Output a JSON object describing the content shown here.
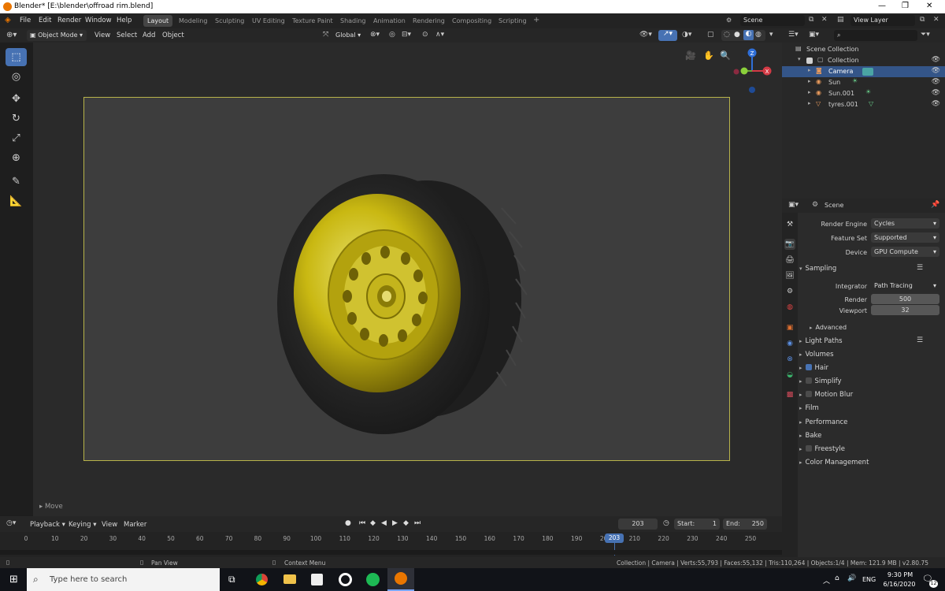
{
  "window": {
    "title": "Blender* [E:\\blender\\offroad rim.blend]",
    "min": "—",
    "restore": "❐",
    "close": "✕"
  },
  "menu": {
    "items": [
      "File",
      "Edit",
      "Render",
      "Window",
      "Help"
    ]
  },
  "workspaces": {
    "tabs": [
      "Layout",
      "Modeling",
      "Sculpting",
      "UV Editing",
      "Texture Paint",
      "Shading",
      "Animation",
      "Rendering",
      "Compositing",
      "Scripting"
    ],
    "add": "+",
    "active": "Layout"
  },
  "topright": {
    "scene": "Scene",
    "view_layer": "View Layer"
  },
  "viewport_header": {
    "mode": "Object Mode",
    "menus": [
      "View",
      "Select",
      "Add",
      "Object"
    ],
    "orientation": "Global"
  },
  "viewport": {
    "last_op": "Move",
    "gizmo_z": "Z",
    "gizmo_x": "X"
  },
  "outliner": {
    "items": [
      {
        "label": "Scene Collection",
        "indent": 0
      },
      {
        "label": "Collection",
        "indent": 1
      },
      {
        "label": "Camera",
        "indent": 2
      },
      {
        "label": "Sun",
        "indent": 2
      },
      {
        "label": "Sun.001",
        "indent": 2
      },
      {
        "label": "tyres.001",
        "indent": 2
      }
    ],
    "selected": "Camera"
  },
  "properties": {
    "context": "Scene",
    "render_engine": {
      "label": "Render Engine",
      "value": "Cycles"
    },
    "feature_set": {
      "label": "Feature Set",
      "value": "Supported"
    },
    "device": {
      "label": "Device",
      "value": "GPU Compute"
    },
    "sampling": {
      "title": "Sampling",
      "integrator_label": "Integrator",
      "integrator": "Path Tracing",
      "render_label": "Render",
      "render": "500",
      "viewport_label": "Viewport",
      "viewport": "32",
      "advanced": "Advanced"
    },
    "sections": [
      {
        "label": "Light Paths",
        "checkbox": null
      },
      {
        "label": "Volumes",
        "checkbox": null
      },
      {
        "label": "Hair",
        "checkbox": true
      },
      {
        "label": "Simplify",
        "checkbox": false
      },
      {
        "label": "Motion Blur",
        "checkbox": false
      },
      {
        "label": "Film",
        "checkbox": null
      },
      {
        "label": "Performance",
        "checkbox": null
      },
      {
        "label": "Bake",
        "checkbox": null
      },
      {
        "label": "Freestyle",
        "checkbox": false
      },
      {
        "label": "Color Management",
        "checkbox": null
      }
    ]
  },
  "timeline": {
    "menus": [
      "Playback",
      "Keying",
      "View",
      "Marker"
    ],
    "current_frame": "203",
    "start_label": "Start:",
    "start": "1",
    "end_label": "End:",
    "end": "250",
    "ticks": [
      "0",
      "10",
      "20",
      "30",
      "40",
      "50",
      "60",
      "70",
      "80",
      "90",
      "100",
      "110",
      "120",
      "130",
      "140",
      "150",
      "160",
      "170",
      "180",
      "190",
      "200",
      "210",
      "220",
      "230",
      "240",
      "250"
    ]
  },
  "status": {
    "pan": "Pan View",
    "context": "Context Menu",
    "info": "Collection | Camera | Verts:55,793 | Faces:55,132 | Tris:110,264 | Objects:1/4 | Mem: 121.9 MB | v2.80.75"
  },
  "taskbar": {
    "search": "Type here to search",
    "lang": "ENG",
    "time": "9:30 PM",
    "date": "6/16/2020",
    "notif": "12"
  }
}
